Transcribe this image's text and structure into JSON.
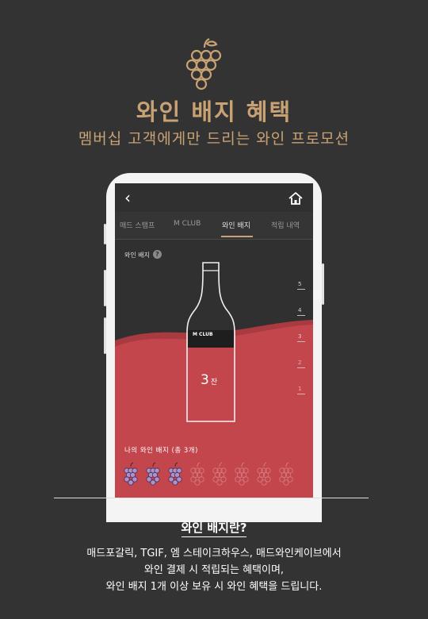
{
  "header": {
    "title": "와인 배지 혜택",
    "subtitle": "멤버십 고객에게만 드리는 와인 프로모션"
  },
  "app": {
    "tabs": [
      {
        "label": "매드 스탬프"
      },
      {
        "label": "M CLUB"
      },
      {
        "label": "와인 배지"
      },
      {
        "label": "적립 내역"
      }
    ],
    "active_tab": "와인 배지",
    "badge_label": "와인 배지",
    "help_symbol": "?",
    "bottle_brand": "M CLUB",
    "glass_count": "3",
    "glass_unit": "잔",
    "levels": [
      "5",
      "4",
      "3",
      "2",
      "1"
    ],
    "my_badges_label": "나의 와인 배지 (총 3개)",
    "badges_earned": 3,
    "badges_total": 8,
    "colors": {
      "wine": "#c2464c",
      "wine_dark": "#a83a40",
      "accent": "#c9a274",
      "earned_grape": "#a993c8",
      "empty_grape": "#d57a7e"
    }
  },
  "info": {
    "title": "와인 배지란?",
    "lines": [
      "매드포갈릭, TGIF, 엠 스테이크하우스, 매드와인케이브에서",
      "와인 결제 시 적립되는 혜택이며,",
      "와인 배지 1개 이상 보유 시 와인 혜택을 드립니다."
    ]
  }
}
